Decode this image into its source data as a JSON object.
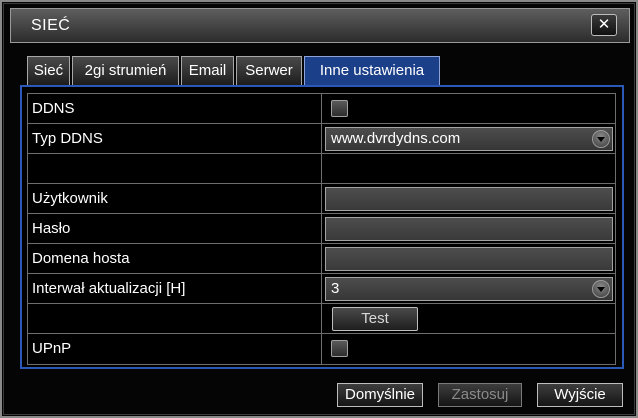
{
  "window": {
    "title": "SIEĆ",
    "close_label": "✕"
  },
  "tabs": [
    {
      "label": "Sieć",
      "active": false
    },
    {
      "label": "2gi strumień",
      "active": false
    },
    {
      "label": "Email",
      "active": false
    },
    {
      "label": "Serwer",
      "active": false
    },
    {
      "label": "Inne ustawienia",
      "active": true
    }
  ],
  "form": {
    "ddns": {
      "label": "DDNS",
      "checked": false
    },
    "ddns_type": {
      "label": "Typ DDNS",
      "value": "www.dvrdydns.com"
    },
    "user": {
      "label": "Użytkownik",
      "value": ""
    },
    "password": {
      "label": "Hasło",
      "value": ""
    },
    "host_domain": {
      "label": "Domena hosta",
      "value": ""
    },
    "update_interval": {
      "label": "Interwał aktualizacji [H]",
      "value": "3"
    },
    "test_button": {
      "label": "Test"
    },
    "upnp": {
      "label": "UPnP",
      "checked": false
    }
  },
  "footer": {
    "default_label": "Domyślnie",
    "apply_label": "Zastosuj",
    "exit_label": "Wyjście"
  },
  "colors": {
    "active_tab": "#1b3f88",
    "panel_border": "#2c58b8"
  }
}
